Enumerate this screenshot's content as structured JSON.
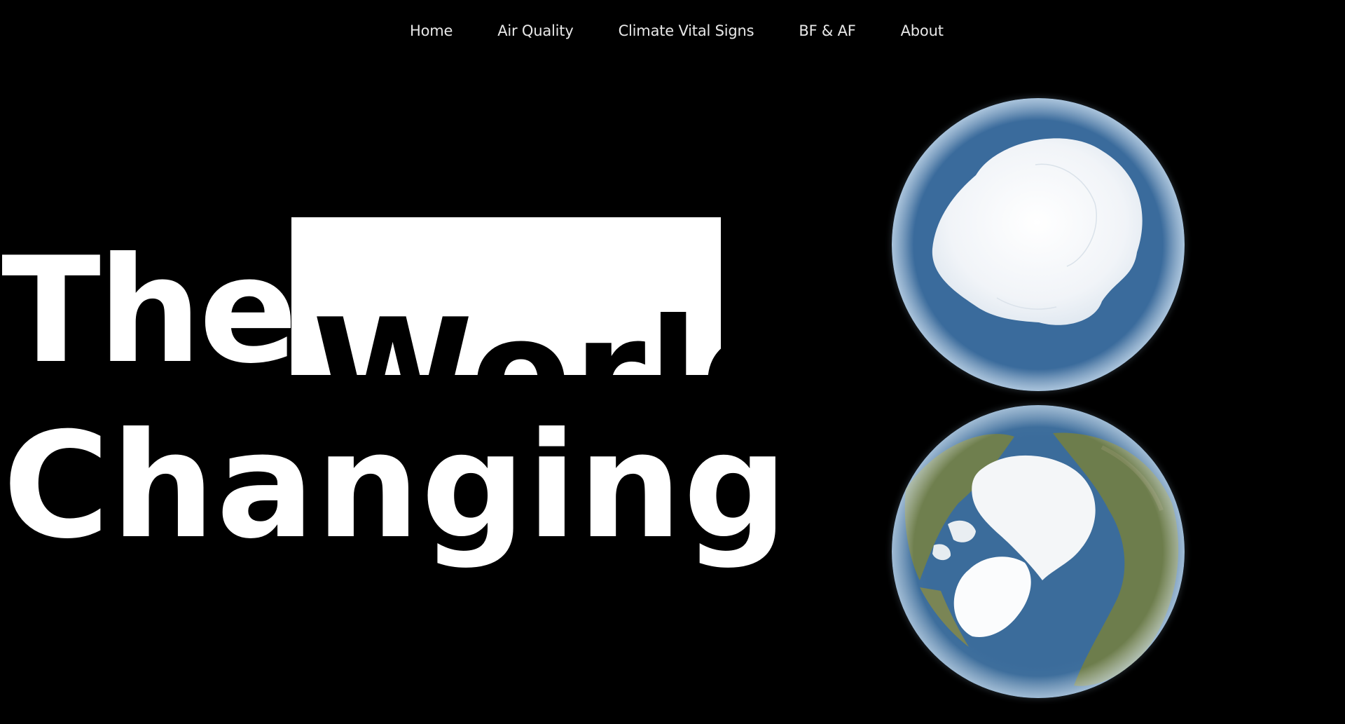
{
  "nav": {
    "items": [
      {
        "label": "Home"
      },
      {
        "label": "Air Quality"
      },
      {
        "label": "Climate Vital Signs"
      },
      {
        "label": "BF & AF"
      },
      {
        "label": "About"
      }
    ]
  },
  "hero": {
    "line1_prefix": "The",
    "line1_highlight": "World",
    "line2": "Changing"
  },
  "globes": {
    "top": "antarctica-globe-icon",
    "bottom": "arctic-globe-icon"
  },
  "colors": {
    "background": "#000000",
    "text": "#ffffff",
    "highlight_box": "#ffffff",
    "ocean": "#3a6b9c",
    "ice": "#f2f5f8",
    "land": "#6f7e4f"
  }
}
